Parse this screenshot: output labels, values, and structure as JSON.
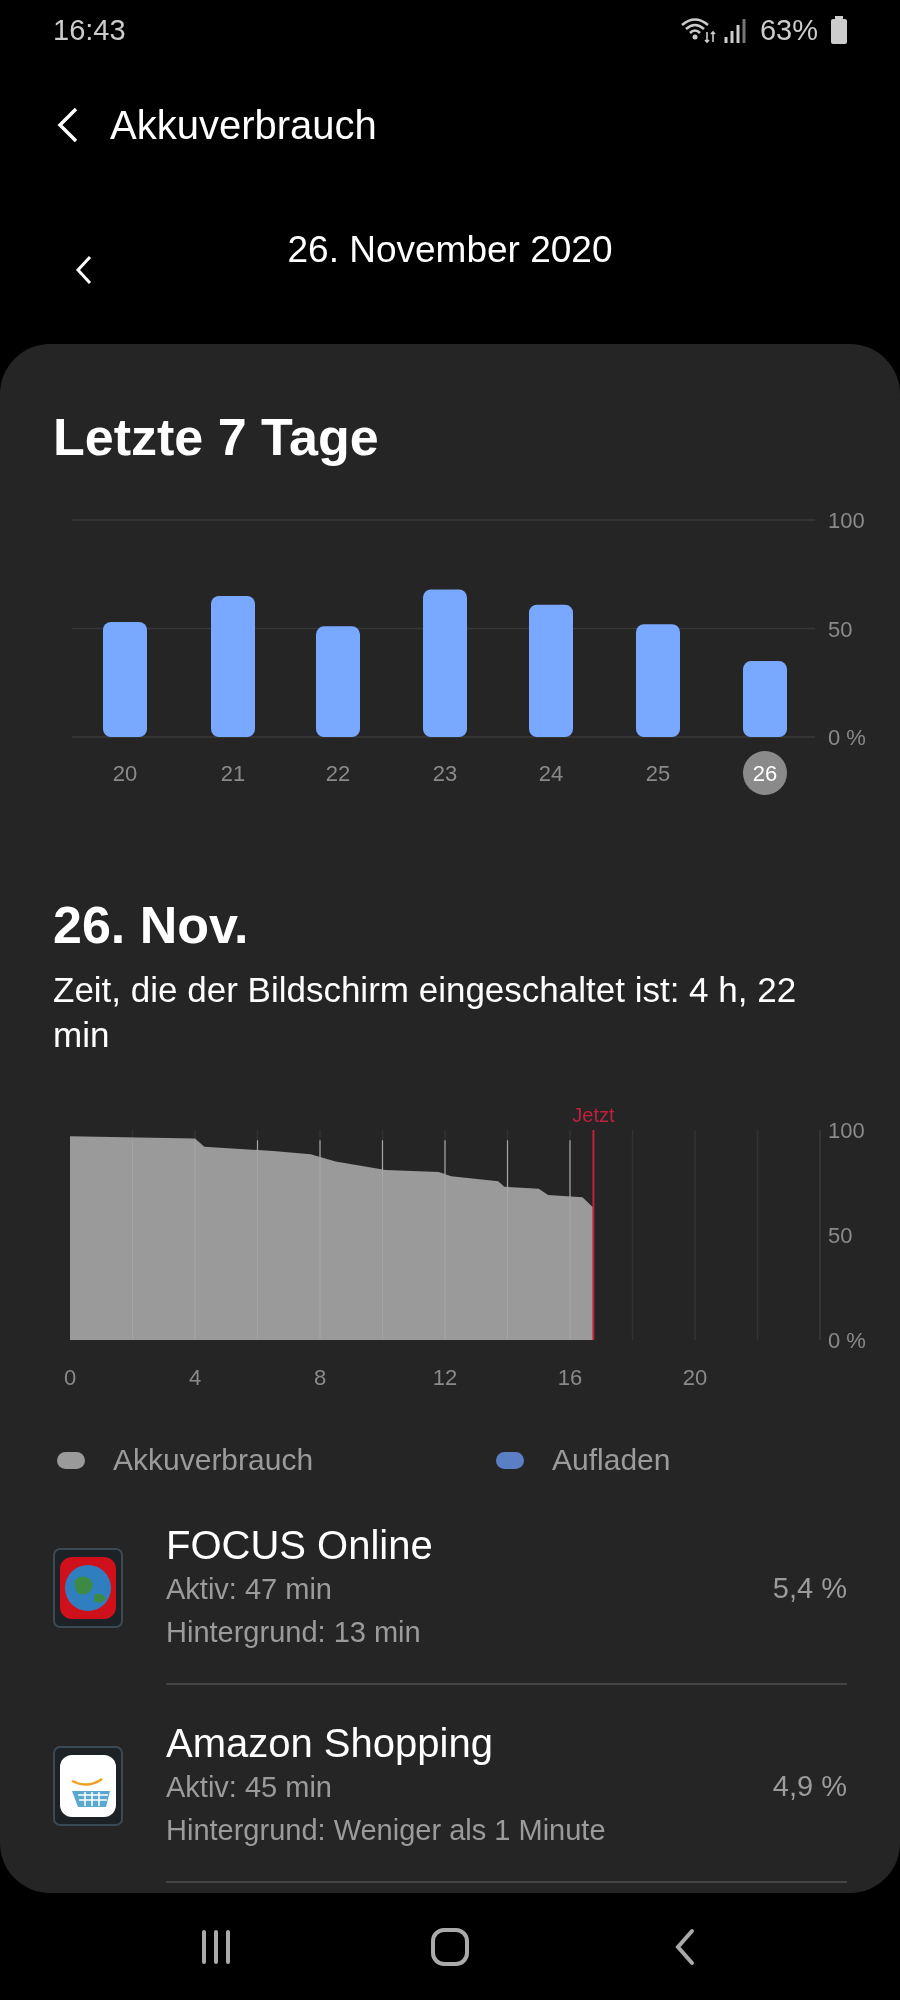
{
  "status_bar": {
    "time": "16:43",
    "battery": "63%"
  },
  "header": {
    "title": "Akkuverbrauch"
  },
  "date_nav": {
    "date": "26. November 2020"
  },
  "week": {
    "title": "Letzte 7 Tage",
    "chart_data": {
      "type": "bar",
      "categories": [
        "20",
        "21",
        "22",
        "23",
        "24",
        "25",
        "26"
      ],
      "values": [
        53,
        65,
        51,
        68,
        61,
        52,
        35
      ],
      "ylim": [
        0,
        100
      ],
      "yticks": [
        {
          "value": 0,
          "label": "0 %"
        },
        50,
        100
      ],
      "color": "#78a8ff"
    },
    "days": [
      {
        "selected": false
      },
      {
        "selected": false
      },
      {
        "selected": false
      },
      {
        "selected": false
      },
      {
        "selected": false
      },
      {
        "selected": false
      },
      {
        "selected": true
      }
    ]
  },
  "day": {
    "title": "26. Nov.",
    "screen_time": "Zeit, die der Bildschirm eingeschaltet ist: 4 h, 22 min",
    "chart_data": {
      "type": "area",
      "x": [
        0,
        4,
        4.3,
        6.5,
        7.7,
        8.5,
        9.3,
        10.1,
        11.8,
        12.2,
        13.7,
        13.9,
        15,
        15.3,
        16.4,
        16.75
      ],
      "series": [
        {
          "name": "Akkuverbrauch",
          "color": "#9a9a9a",
          "values": [
            97,
            96,
            92,
            90,
            88.5,
            85,
            83,
            81,
            80,
            78,
            75.6,
            73,
            72,
            69,
            68,
            63
          ]
        },
        {
          "name": "Aufladen",
          "color": "#5b7fc4",
          "values": [
            null,
            null,
            null,
            null,
            null,
            null,
            null,
            null,
            null,
            null,
            null,
            null,
            null,
            null,
            null,
            null
          ]
        }
      ],
      "xlim": [
        0,
        24
      ],
      "ylim": [
        0,
        100
      ],
      "xticks": [
        0,
        4,
        8,
        12,
        16,
        20
      ],
      "yticks": [
        {
          "value": 0,
          "label": "0 %"
        },
        50,
        100
      ],
      "grid": true,
      "ref_lines": [
        {
          "axis": "x",
          "value": 16.75,
          "label": "Jetzt",
          "color": "#c0203c"
        }
      ]
    }
  },
  "apps": [
    {
      "kind": "globe",
      "name": "FOCUS Online",
      "active": "Aktiv: 47 min",
      "background": "Hintergrund: 13 min",
      "percent": "5,4 %"
    },
    {
      "kind": "cart",
      "name": "Amazon Shopping",
      "active": "Aktiv: 45 min",
      "background": "Hintergrund: Weniger als 1 Minute",
      "percent": "4,9 %"
    }
  ]
}
